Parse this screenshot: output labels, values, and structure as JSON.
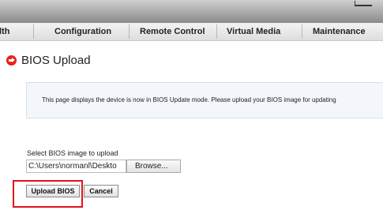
{
  "nav": {
    "items": [
      {
        "label": "lth"
      },
      {
        "label": "Configuration"
      },
      {
        "label": "Remote Control"
      },
      {
        "label": "Virtual Media"
      },
      {
        "label": "Maintenance"
      }
    ]
  },
  "page": {
    "title": "BIOS Upload",
    "info_text": "This page displays the device is now in BIOS Update mode. Please upload your BIOS image for updating"
  },
  "upload": {
    "select_label": "Select BIOS image to upload",
    "file_path_value": "C:\\Users\\normanl\\Deskto",
    "browse_label": "Browse...",
    "upload_label": "Upload BIOS",
    "cancel_label": "Cancel"
  },
  "colors": {
    "highlight": "#e3121c",
    "heading_icon": "#e2231a"
  }
}
